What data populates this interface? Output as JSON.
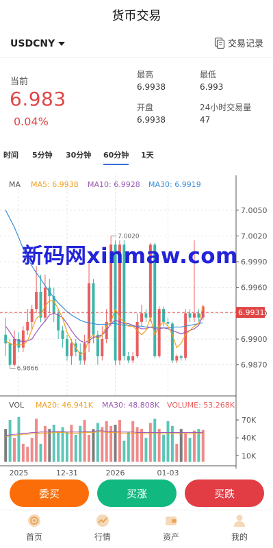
{
  "header": {
    "title": "货币交易"
  },
  "pair_bar": {
    "pair": "USDCNY",
    "records_label": "交易记录"
  },
  "quote": {
    "current_label": "当前",
    "price": "6.983",
    "change": "0.04%",
    "high_label": "最高",
    "high": "6.9938",
    "low_label": "最低",
    "low": "6.993",
    "open_label": "开盘",
    "open": "6.9938",
    "volume_label": "24小时交易量",
    "volume": "47"
  },
  "periods": [
    {
      "label": "时间"
    },
    {
      "label": "5分钟"
    },
    {
      "label": "30分钟"
    },
    {
      "label": "60分钟",
      "active": true
    },
    {
      "label": "1天"
    }
  ],
  "chart_data": {
    "type": "candlestick",
    "ma_legend": {
      "ma": "MA",
      "ma5": "MA5: 6.9938",
      "ma10": "MA10: 6.9928",
      "ma30": "MA30: 6.9919"
    },
    "price_axis_ticks": [
      "7.0050",
      "7.0020",
      "6.9990",
      "6.9960",
      "6.9930",
      "6.9900",
      "6.9870"
    ],
    "current_price_tag": "6.9931",
    "max_marker": "7.0020",
    "min_marker": "6.9866",
    "x_axis_ticks": [
      "2025",
      "12-31",
      "2026",
      "01-03"
    ],
    "ylim": [
      6.9845,
      7.0065
    ],
    "colors": {
      "up": "#e85e5e",
      "down": "#3cb5a8",
      "ma5": "#f0a020",
      "ma10": "#9b59b6",
      "ma30": "#3a8fd8"
    },
    "candles": [
      {
        "o": 6.9905,
        "c": 6.9895,
        "h": 6.9925,
        "l": 6.988
      },
      {
        "o": 6.9895,
        "c": 6.987,
        "h": 6.99,
        "l": 6.9866
      },
      {
        "o": 6.987,
        "c": 6.99,
        "h": 6.991,
        "l": 6.9868
      },
      {
        "o": 6.99,
        "c": 6.989,
        "h": 6.9908,
        "l": 6.9885
      },
      {
        "o": 6.989,
        "c": 6.991,
        "h": 6.9915,
        "l": 6.9885
      },
      {
        "o": 6.991,
        "c": 6.992,
        "h": 6.9935,
        "l": 6.9905
      },
      {
        "o": 6.992,
        "c": 6.9935,
        "h": 6.994,
        "l": 6.991
      },
      {
        "o": 6.9935,
        "c": 6.9955,
        "h": 6.9985,
        "l": 6.993
      },
      {
        "o": 6.9955,
        "c": 6.9925,
        "h": 6.9975,
        "l": 6.992
      },
      {
        "o": 6.9925,
        "c": 6.996,
        "h": 6.9975,
        "l": 6.992
      },
      {
        "o": 6.996,
        "c": 6.995,
        "h": 6.997,
        "l": 6.993
      },
      {
        "o": 6.995,
        "c": 6.993,
        "h": 6.996,
        "l": 6.992
      },
      {
        "o": 6.993,
        "c": 6.991,
        "h": 6.9935,
        "l": 6.99
      },
      {
        "o": 6.991,
        "c": 6.99,
        "h": 6.9915,
        "l": 6.989
      },
      {
        "o": 6.99,
        "c": 6.988,
        "h": 6.9905,
        "l": 6.9875
      },
      {
        "o": 6.988,
        "c": 6.9895,
        "h": 6.99,
        "l": 6.987
      },
      {
        "o": 6.9895,
        "c": 6.9885,
        "h": 6.99,
        "l": 6.988
      },
      {
        "o": 6.9885,
        "c": 6.9875,
        "h": 6.9895,
        "l": 6.987
      },
      {
        "o": 6.9875,
        "c": 6.9895,
        "h": 6.9905,
        "l": 6.987
      },
      {
        "o": 6.9895,
        "c": 6.9965,
        "h": 6.999,
        "l": 6.9885
      },
      {
        "o": 6.9965,
        "c": 6.9905,
        "h": 6.997,
        "l": 6.9895
      },
      {
        "o": 6.9905,
        "c": 6.988,
        "h": 6.991,
        "l": 6.987
      },
      {
        "o": 6.988,
        "c": 6.99,
        "h": 6.9915,
        "l": 6.9875
      },
      {
        "o": 6.99,
        "c": 6.992,
        "h": 6.9935,
        "l": 6.9895
      },
      {
        "o": 6.992,
        "c": 7.001,
        "h": 7.002,
        "l": 6.9915
      },
      {
        "o": 7.001,
        "c": 6.9875,
        "h": 7.0015,
        "l": 6.987
      },
      {
        "o": 6.9875,
        "c": 7.001,
        "h": 7.0015,
        "l": 6.987
      },
      {
        "o": 7.001,
        "c": 6.988,
        "h": 7.0015,
        "l": 6.9875
      },
      {
        "o": 6.988,
        "c": 6.9875,
        "h": 6.9885,
        "l": 6.9872
      },
      {
        "o": 6.9875,
        "c": 6.988,
        "h": 6.9885,
        "l": 6.9872
      },
      {
        "o": 6.988,
        "c": 6.992,
        "h": 6.993,
        "l": 6.9878
      },
      {
        "o": 6.992,
        "c": 6.993,
        "h": 6.994,
        "l": 6.9915
      },
      {
        "o": 6.993,
        "c": 6.9925,
        "h": 6.9935,
        "l": 6.992
      },
      {
        "o": 6.9925,
        "c": 7.001,
        "h": 7.0012,
        "l": 6.992
      },
      {
        "o": 7.001,
        "c": 6.988,
        "h": 7.0012,
        "l": 6.9878
      },
      {
        "o": 6.988,
        "c": 6.9935,
        "h": 6.9938,
        "l": 6.9878
      },
      {
        "o": 6.9935,
        "c": 6.992,
        "h": 6.9938,
        "l": 6.9915
      },
      {
        "o": 6.992,
        "c": 6.9918,
        "h": 6.9925,
        "l": 6.9915
      },
      {
        "o": 6.9918,
        "c": 6.9875,
        "h": 6.992,
        "l": 6.9872
      },
      {
        "o": 6.9875,
        "c": 6.988,
        "h": 6.9882,
        "l": 6.9872
      },
      {
        "o": 6.988,
        "c": 6.9878,
        "h": 6.9882,
        "l": 6.9875
      },
      {
        "o": 6.9878,
        "c": 6.993,
        "h": 6.9935,
        "l": 6.9875
      },
      {
        "o": 6.993,
        "c": 6.9925,
        "h": 6.9935,
        "l": 6.992
      },
      {
        "o": 6.9925,
        "c": 6.993,
        "h": 7.0015,
        "l": 6.992
      },
      {
        "o": 6.993,
        "c": 6.9925,
        "h": 6.9935,
        "l": 6.992
      },
      {
        "o": 6.9925,
        "c": 6.9938,
        "h": 6.994,
        "l": 6.9922
      }
    ],
    "ma5": [
      6.9898,
      6.9895,
      6.9893,
      6.9894,
      6.9893,
      6.9898,
      6.9911,
      6.9924,
      6.9928,
      6.9938,
      6.9945,
      6.9944,
      6.9935,
      6.9924,
      6.9908,
      6.9898,
      6.989,
      6.9882,
      6.9885,
      6.99,
      6.9905,
      6.99,
      6.9905,
      6.9915,
      6.992,
      6.9935,
      6.9925,
      6.992,
      6.9915,
      6.9915,
      6.991,
      6.9905,
      6.991,
      6.9925,
      6.9905,
      6.9915,
      6.992,
      6.9915,
      6.9905,
      6.989,
      6.9895,
      6.9905,
      6.991,
      6.9915,
      6.9918,
      6.9938
    ],
    "ma10": [
      6.9915,
      6.9908,
      6.99,
      6.9898,
      6.9897,
      6.9898,
      6.99,
      6.9908,
      6.9915,
      6.9921,
      6.9928,
      6.993,
      6.9928,
      6.9925,
      6.9918,
      6.991,
      6.9903,
      6.9898,
      6.9896,
      6.9898,
      6.9902,
      6.9903,
      6.9905,
      6.991,
      6.9918,
      6.9922,
      6.992,
      6.9918,
      6.9918,
      6.9916,
      6.9914,
      6.9912,
      6.9912,
      6.9914,
      6.9912,
      6.9912,
      6.9913,
      6.9912,
      6.991,
      6.9908,
      6.9906,
      6.9908,
      6.991,
      6.9912,
      6.9916,
      6.9928
    ],
    "ma30": [
      7.005,
      7.004,
      7.003,
      7.0018,
      7.0005,
      6.9995,
      6.9985,
      6.9977,
      6.997,
      6.9962,
      6.9955,
      6.9948,
      6.9942,
      6.9937,
      6.9932,
      6.9928,
      6.9925,
      6.9922,
      6.992,
      6.9919,
      6.9918,
      6.9917,
      6.9917,
      6.9917,
      6.9918,
      6.9918,
      6.9917,
      6.9916,
      6.9916,
      6.9915,
      6.9915,
      6.9915,
      6.9914,
      6.9914,
      6.9914,
      6.9913,
      6.9913,
      6.9913,
      6.9914,
      6.9914,
      6.9914,
      6.9915,
      6.9916,
      6.9917,
      6.9918,
      6.9919
    ],
    "vol_legend": {
      "vol": "VOL",
      "ma20": "MA20: 46.941K",
      "ma30": "MA30: 48.808K",
      "volume": "VOLUME: 53.268K"
    },
    "vol_axis_ticks": [
      "70K",
      "40K",
      "10K"
    ],
    "vol_ylim": [
      0,
      85
    ],
    "volumes": [
      55,
      70,
      40,
      75,
      30,
      25,
      40,
      72,
      30,
      60,
      55,
      62,
      50,
      58,
      50,
      62,
      45,
      60,
      70,
      45,
      55,
      65,
      58,
      68,
      60,
      62,
      70,
      35,
      50,
      68,
      58,
      55,
      40,
      65,
      72,
      55,
      45,
      68,
      60,
      30,
      55,
      48,
      40,
      52,
      55,
      53.268
    ],
    "vol_ma": [
      42,
      43,
      44,
      45,
      46,
      46,
      47,
      47,
      48,
      48,
      48,
      49,
      49,
      49,
      48,
      48,
      48,
      48,
      49,
      49,
      49,
      50,
      50,
      49,
      49,
      49,
      48,
      48,
      48,
      48,
      47,
      47,
      47,
      47,
      47,
      47,
      47,
      47,
      47,
      47,
      47,
      47,
      47,
      47,
      47,
      46.941
    ]
  },
  "actions": {
    "left": "委买",
    "middle": "买涨",
    "right": "买跌"
  },
  "tabs": [
    {
      "label": "首页",
      "icon": "home-icon"
    },
    {
      "label": "行情",
      "icon": "market-icon"
    },
    {
      "label": "资产",
      "icon": "wallet-icon"
    },
    {
      "label": "我的",
      "icon": "user-icon"
    }
  ],
  "watermark": "新码网xinmaw.com"
}
